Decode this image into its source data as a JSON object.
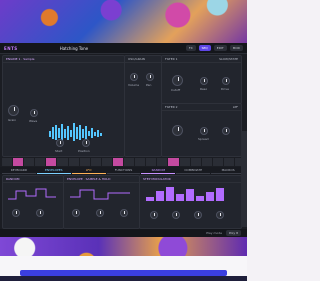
{
  "app": {
    "title_left": "ENTS",
    "preset_name": "Hatching Tone"
  },
  "header_buttons": [
    "FX",
    "SEQ",
    "EDIT",
    "MOD"
  ],
  "panels": {
    "engine": {
      "title": "ENGINE 1 · Sample"
    },
    "osc": {
      "title": "OSC/GRAIN"
    },
    "filter1": {
      "title": "FILTER 1",
      "mode": "SLOW/STATE"
    },
    "filter2": {
      "title": "FILTER 2",
      "mode": "LPF"
    }
  },
  "knob_labels": {
    "grain": "Grain",
    "wave": "Wave",
    "start": "Start",
    "position": "Position",
    "cutoff": "Cutoff",
    "reso": "Reso",
    "volume": "Volume",
    "drive": "Drive",
    "spread": "Spread",
    "pan": "Pan"
  },
  "mod_tabs": [
    "KEYBOARD",
    "ENVELOPES",
    "LFO",
    "FUNCTIONS",
    "RANDOM",
    "COMBINATE",
    "MACROS"
  ],
  "mod_panels": {
    "left": "RANDOM",
    "mid": "ENVELOPE · SAMPLE & HOLD",
    "right": "STEP MODULATOR"
  },
  "bottom_bar": {
    "label": "Play mode",
    "value": "Poly 8"
  },
  "colors": {
    "accent": "#c97dff",
    "active": "#5e46e6",
    "panel": "#22252d"
  }
}
